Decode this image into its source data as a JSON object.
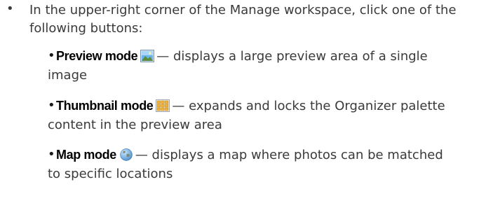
{
  "intro": {
    "bullet": "•",
    "text": "In the upper-right corner of the Manage workspace, click one of the following buttons:"
  },
  "modes": [
    {
      "bullet": "•",
      "term": "Preview mode",
      "icon": "preview-mode-icon",
      "desc_line1": "— displays a large preview area of a single",
      "desc_line2": "image"
    },
    {
      "bullet": "•",
      "term": "Thumbnail mode",
      "icon": "thumbnail-mode-icon",
      "desc_line1": "— expands and locks the Organizer palette",
      "desc_line2": "content in the preview area"
    },
    {
      "bullet": "•",
      "term": "Map mode",
      "icon": "map-mode-icon",
      "desc_line1": "— displays a map where photos can be matched",
      "desc_line2": "to specific locations"
    }
  ],
  "colors": {
    "body_text": "#3a3a3a",
    "term_text": "#000000",
    "icon_blue": "#4a8fd0"
  }
}
